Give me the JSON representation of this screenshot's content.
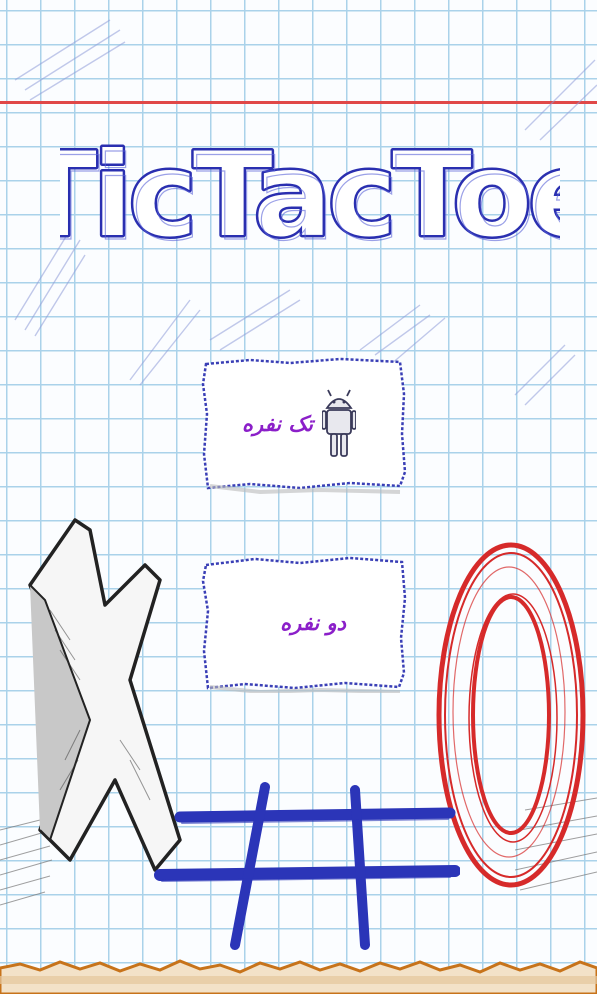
{
  "game": {
    "title": "TicTacToe"
  },
  "menu": {
    "single_player_label": "تک نفره",
    "two_player_label": "دو نفره"
  },
  "icons": {
    "single_player": "android-icon"
  },
  "colors": {
    "title_ink": "#2a2fb0",
    "label_purple": "#8b1fc9",
    "x_ink": "#222222",
    "o_ink": "#d62a2a",
    "grid_ink": "#2b35b8",
    "margin_line": "#e04848",
    "paper_grid": "#aad2ea",
    "torn_edge": "#c7731a"
  }
}
